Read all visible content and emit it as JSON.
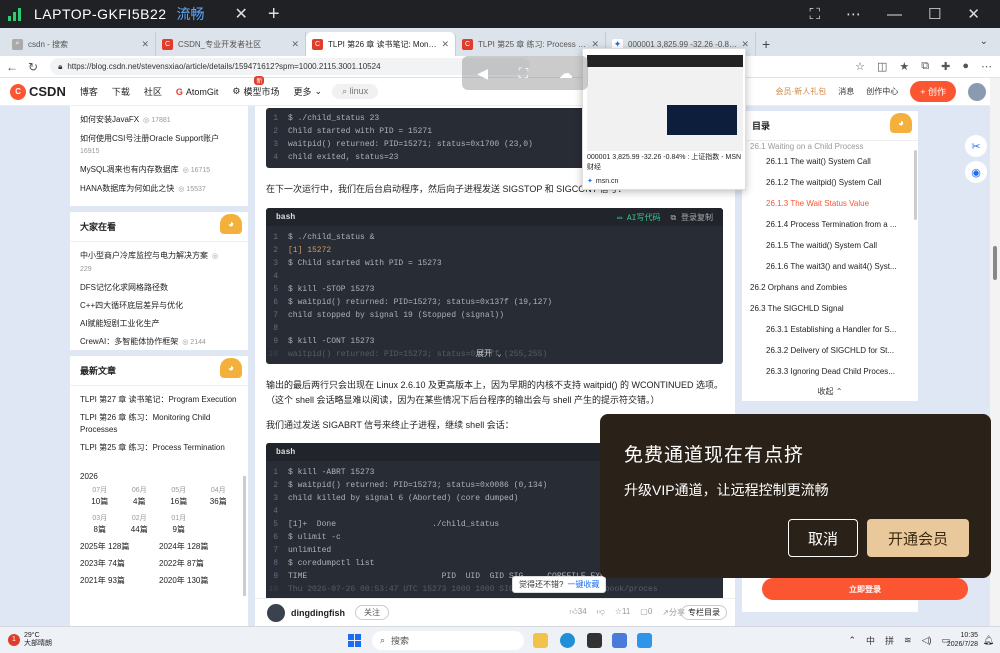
{
  "remote": {
    "title": "LAPTOP-GKFI5B22",
    "quality": "流畅"
  },
  "tabs": [
    {
      "label": "csdn - 搜索"
    },
    {
      "label": "CSDN_专业开发者社区"
    },
    {
      "label": "TLPI 第26 章 读书笔记: Monitoring..."
    },
    {
      "label": "TLPI 第25 章 练习: Process Termin..."
    },
    {
      "label": "000001 3,825.99 -32.26 -0.84% : 上..."
    }
  ],
  "address": {
    "url": "https://blog.csdn.net/stevensxiao/article/details/159471612?spm=1000.2115.3001.10524"
  },
  "nav": {
    "logo": "CSDN",
    "items": [
      "博客",
      "下载",
      "社区",
      "AtomGit",
      "模型市场",
      "更多"
    ],
    "hot_badge": "新",
    "search_chip": "linux",
    "vip": "会员·新人礼包",
    "messages": "消息",
    "center": "创作中心",
    "create": "创作"
  },
  "left_top": [
    {
      "title": "如何安装JavaFX",
      "count": "17881"
    },
    {
      "title": "如何使用CSI号注册Oracle Support账户",
      "count": "16915"
    },
    {
      "title": "MySQL凋来也有内存数据库",
      "count": "16715"
    },
    {
      "title": "HANA数据库为何如此之快",
      "count": "15537"
    }
  ],
  "everyone_watching": {
    "heading": "大家在看",
    "items": [
      {
        "title": "中小型商户冷库监控与电力解决方案",
        "count": "229"
      },
      {
        "title": "DFS记忆化求网格路径数",
        "count": ""
      },
      {
        "title": "C++四大循环底层差异与优化",
        "count": ""
      },
      {
        "title": "AI赋能短剧工业化生产",
        "count": ""
      },
      {
        "title": "CrewAI：多智能体协作框架",
        "count": "2144"
      }
    ]
  },
  "latest": {
    "heading": "最新文章",
    "items": [
      "TLPI 第27 章 读书笔记：Program Execution",
      "TLPI 第26 章 练习：Monitoring Child Processes",
      "TLPI 第25 章 练习：Process Termination"
    ],
    "year": "2026",
    "months": [
      {
        "m": "07月",
        "n": "10篇"
      },
      {
        "m": "06月",
        "n": "4篇"
      },
      {
        "m": "05月",
        "n": "16篇"
      },
      {
        "m": "04月",
        "n": "36篇"
      },
      {
        "m": "03月",
        "n": "8篇"
      },
      {
        "m": "02月",
        "n": "44篇"
      },
      {
        "m": "01月",
        "n": "9篇"
      }
    ],
    "years": [
      {
        "y": "2025年",
        "n": "128篇"
      },
      {
        "y": "2024年",
        "n": "128篇"
      },
      {
        "y": "2023年",
        "n": "74篇"
      },
      {
        "y": "2022年",
        "n": "87篇"
      },
      {
        "y": "2021年",
        "n": "93篇"
      },
      {
        "y": "2020年",
        "n": "130篇"
      }
    ]
  },
  "article": {
    "code1": [
      "$ ./child_status 23",
      "Child started with PID = 15271",
      "waitpid() returned: PID=15271; status=0x1700 (23,0)",
      "child exited, status=23"
    ],
    "para1": "在下一次运行中，我们在后台启动程序，然后向子进程发送 SIGSTOP 和 SIGCONT 信号：",
    "code2_lang": "bash",
    "code2_ai": "AI写代码",
    "code2_copy": "登录复制",
    "code2": [
      "$ ./child_status &",
      "[1] 15272",
      "$ Child started with PID = 15273",
      "",
      "$ kill -STOP 15273",
      "$ waitpid() returned: PID=15273; status=0x137f (19,127)",
      "child stopped by signal 19 (Stopped (signal))",
      "",
      "$ kill -CONT 15273",
      "waitpid() returned: PID=15273; status=0xffff (255,255)"
    ],
    "expand": "展开",
    "para2": "输出的最后两行只会出现在 Linux 2.6.10 及更高版本上，因为早期的内核不支持 waitpid() 的 WCONTINUED 选项。（这个 shell 会话略显难以阅读，因为在某些情况下后台程序的输出会与 shell 产生的提示符交错。）",
    "para3": "我们通过发送 SIGABRT 信号来终止子进程，继续 shell 会话：",
    "code3_lang": "bash",
    "code3": [
      "$ kill -ABRT 15273",
      "$ waitpid() returned: PID=15273; status=0x0086 (0,134)",
      "child killed by signal 6 (Aborted) (core dumped)",
      "",
      "[1]+  Done                    ./child_status",
      "$ ulimit -c",
      "unlimited",
      "$ coredumpctl list",
      "TIME                            PID  UID  GID SIG     COREFILE EXE",
      "Thu 2026-07-26 00:53:47 UTC 15273 1000 1000 SIGABRT present  /tlpi-book/proces"
    ]
  },
  "bottom": {
    "author": "dingdingfish",
    "follow": "关注",
    "likes": "34",
    "dislikes": "",
    "stars": "11",
    "comments": "0",
    "share": "分享",
    "toc": "专栏目录",
    "feedback_q": "觉得还不错?",
    "feedback_a": "一键收藏"
  },
  "toc": {
    "heading": "目录",
    "items": [
      {
        "t": "26.1 Waiting on a Child Process",
        "level": 1
      },
      {
        "t": "26.1.1 The wait() System Call",
        "level": 2
      },
      {
        "t": "26.1.2 The waitpid() System Call",
        "level": 2
      },
      {
        "t": "26.1.3 The Wait Status Value",
        "level": 2,
        "selected": true
      },
      {
        "t": "26.1.4 Process Termination from a ...",
        "level": 2
      },
      {
        "t": "26.1.5 The waitid() System Call",
        "level": 2
      },
      {
        "t": "26.1.6 The wait3() and wait4() Syst...",
        "level": 2
      },
      {
        "t": "26.2 Orphans and Zombies",
        "level": 1
      },
      {
        "t": "26.3 The SIGCHLD Signal",
        "level": 1
      },
      {
        "t": "26.3.1 Establishing a Handler for S...",
        "level": 2
      },
      {
        "t": "26.3.2 Delivery of SIGCHLD for St...",
        "level": 2
      },
      {
        "t": "26.3.3 Ignoring Dead Child Proces...",
        "level": 2
      }
    ],
    "fold": "收起"
  },
  "msn_popup": {
    "caption": "000001 3,825.99 -32.26 -0.84% : 上证指数 - MSN 财经",
    "source": "msn.cn"
  },
  "vip_popup": {
    "title": "免费通道现在有点挤",
    "subtitle": "升级VIP通道，让远程控制更流畅",
    "cancel": "取消",
    "open": "开通会员"
  },
  "login_button": "立即登录",
  "taskbar": {
    "temp": "29°C",
    "weather": "大部晴朗",
    "search": "搜索",
    "lang": "中",
    "ime": "拼",
    "time": "10:35",
    "date": "2026/7/28"
  },
  "colors": {
    "accent": "#fc5531",
    "code_bg": "#282c34",
    "vip_bg": "#2a2118",
    "vip_btn": "#e9c99c"
  }
}
